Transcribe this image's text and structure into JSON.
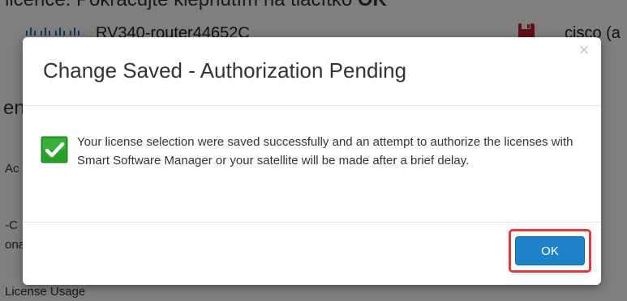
{
  "caption": {
    "text": "licence. Pokračujte klepnutím na tlačítko ",
    "bold": "OK"
  },
  "header": {
    "device_name": "RV340-router44652C",
    "user": "cisco (a"
  },
  "background": {
    "label_heading": "en",
    "label_a": "Ac",
    "label_c": "-C",
    "label_d": "ona",
    "license_usage": "License Usage"
  },
  "modal": {
    "title": "Change Saved - Authorization Pending",
    "close_glyph": "×",
    "message": "Your license selection were saved successfully and an attempt to authorize the licenses with Smart Software Manager or your satellite will be made after a brief delay.",
    "ok_label": "OK"
  },
  "colors": {
    "ok_button": "#1e82c8",
    "highlight": "#e0383e",
    "check_green": "#2aa02a",
    "save_icon": "#c0202a"
  }
}
